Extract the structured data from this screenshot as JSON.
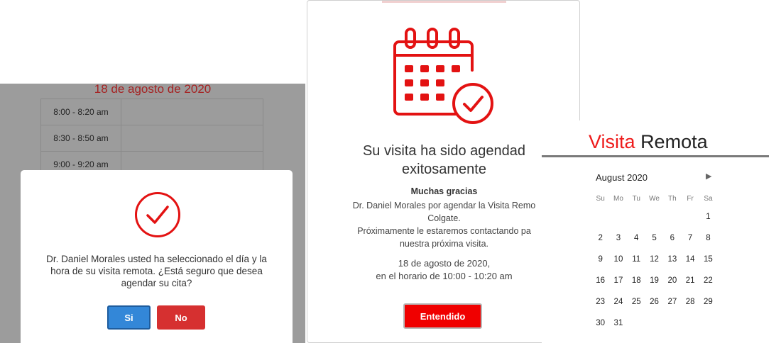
{
  "schedule_panel": {
    "date_title": "18 de agosto de 2020",
    "slots": [
      "8:00 - 8:20 am",
      "8:30 - 8:50 am",
      "9:00 - 9:20 am"
    ]
  },
  "confirm_dialog": {
    "message": "Dr. Daniel Morales usted ha seleccionado el día y la hora de su visita remota. ¿Está seguro que desea agendar su cita?",
    "yes_label": "Si",
    "no_label": "No",
    "icon": "check-circle-icon"
  },
  "success_modal": {
    "icon": "calendar-check-icon",
    "heading_line1": "Su visita ha sido agendad",
    "heading_line2": "exitosamente",
    "thanks": "Muchas gracias",
    "body_lines": [
      "Dr. Daniel Morales por agendar la Visita Remo",
      "Colgate.",
      "Próximamente le estaremos contactando pa",
      "nuestra próxima visita."
    ],
    "date_line1": "18 de agosto de 2020,",
    "date_line2": "en el horario de 10:00 - 10:20 am",
    "ok_label": "Entendido"
  },
  "date_picker": {
    "brand_red": "Visita",
    "brand_dark": "Remota",
    "month_label": "August 2020",
    "next_icon": "triangle-right-icon",
    "weekdays": [
      "Su",
      "Mo",
      "Tu",
      "We",
      "Th",
      "Fr",
      "Sa"
    ],
    "weeks": [
      [
        "",
        "",
        "",
        "",
        "",
        "",
        "1"
      ],
      [
        "2",
        "3",
        "4",
        "5",
        "6",
        "7",
        "8"
      ],
      [
        "9",
        "10",
        "11",
        "12",
        "13",
        "14",
        "15"
      ],
      [
        "16",
        "17",
        "18",
        "19",
        "20",
        "21",
        "22"
      ],
      [
        "23",
        "24",
        "25",
        "26",
        "27",
        "28",
        "29"
      ],
      [
        "30",
        "31",
        "",
        "",
        "",
        "",
        ""
      ]
    ]
  },
  "colors": {
    "accent_red": "#ee1b1b",
    "primary_blue": "#3387d8",
    "danger_red": "#d63030"
  }
}
